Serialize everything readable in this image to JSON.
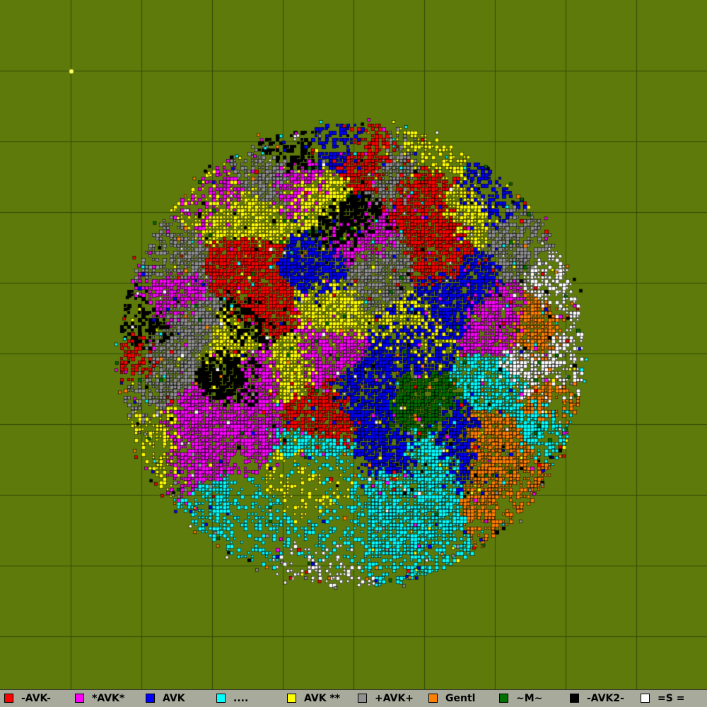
{
  "map": {
    "background": "#5e7a0a",
    "grid_color": "#2e4a06",
    "grid_cells": 10,
    "highlight_marker": "#ffff66"
  },
  "legend": [
    {
      "name": "-AVK-",
      "color": "#ff0000"
    },
    {
      "name": "*AVK*",
      "color": "#ff00ff"
    },
    {
      "name": "AVK",
      "color": "#0000ff"
    },
    {
      "name": "....",
      "color": "#00ffff"
    },
    {
      "name": "AVK **",
      "color": "#ffff00"
    },
    {
      "name": "+AVK+",
      "color": "#909090"
    },
    {
      "name": "Gentl",
      "color": "#ff8000"
    },
    {
      "name": "~M~",
      "color": "#007000"
    },
    {
      "name": "-AVK2-",
      "color": "#000000"
    },
    {
      "name": "=S =",
      "color": "#ffffff"
    }
  ]
}
